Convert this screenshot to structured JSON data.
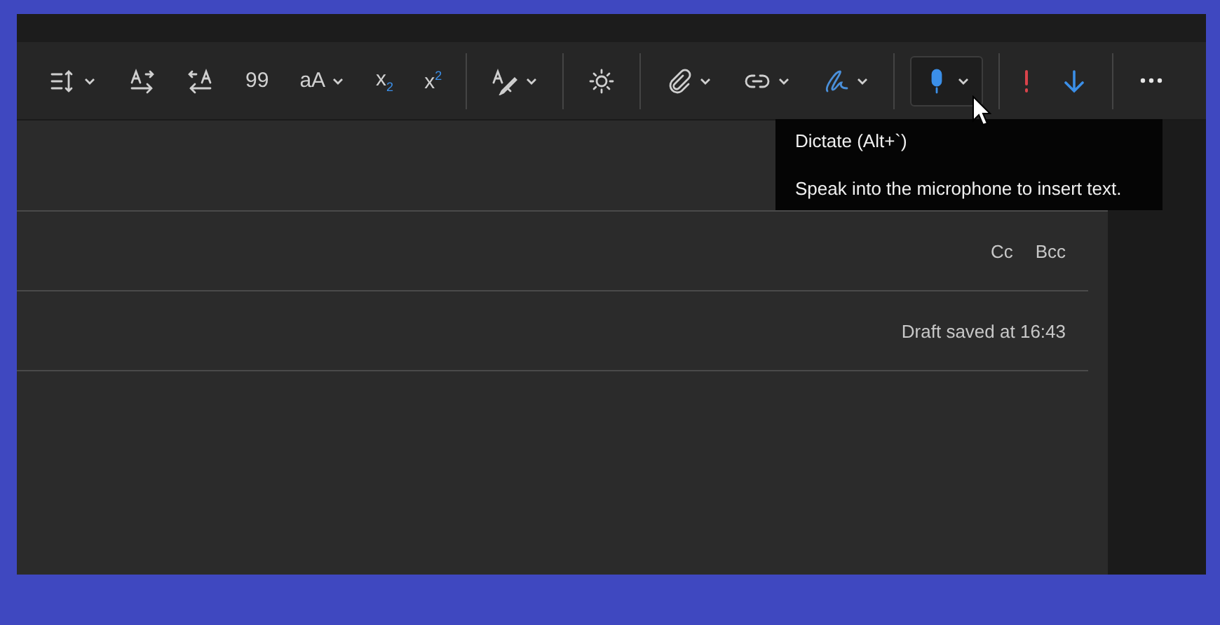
{
  "toolbar": [
    {
      "items": [
        {
          "kind": "icon",
          "dropdown": true,
          "selected": false
        },
        {
          "kind": "icon",
          "dropdown": false,
          "selected": false
        },
        {
          "kind": "icon",
          "dropdown": false,
          "selected": false
        },
        {
          "kind": "text",
          "label": "99",
          "dropdown": false,
          "selected": false
        },
        {
          "kind": "text",
          "label": "aA",
          "dropdown": true,
          "selected": false
        },
        {
          "kind": "text",
          "label": "x$_{2}$",
          "dropdown": false,
          "selected": false
        },
        {
          "kind": "text",
          "label": "x$^{2}$",
          "dropdown": false,
          "selected": false
        }
      ]
    },
    {
      "items": [
        {
          "kind": "icon",
          "dropdown": true,
          "selected": false
        }
      ]
    },
    {
      "items": [
        {
          "kind": "icon",
          "dropdown": false,
          "selected": false
        }
      ]
    },
    {
      "items": [
        {
          "kind": "icon",
          "dropdown": true,
          "selected": false
        },
        {
          "kind": "icon",
          "dropdown": true,
          "selected": false
        },
        {
          "kind": "icon",
          "dropdown": true,
          "selected": false
        }
      ]
    },
    {
      "items": [
        {
          "kind": "icon",
          "dropdown": true,
          "selected": true
        }
      ]
    },
    {
      "items": [
        {
          "kind": "icon",
          "dropdown": false,
          "selected": false
        },
        {
          "kind": "icon",
          "dropdown": false,
          "selected": false
        }
      ]
    },
    {
      "items": [
        {
          "kind": "icon",
          "dropdown": false,
          "selected": false
        }
      ]
    }
  ],
  "tooltip": {
    "title": "Dictate (Alt+`)",
    "body": "Speak into the microphone to insert text."
  },
  "fields": [
    {
      "links": [
        "Cc",
        "Bcc"
      ]
    },
    {
      "status": "Draft saved at 16:43"
    }
  ]
}
